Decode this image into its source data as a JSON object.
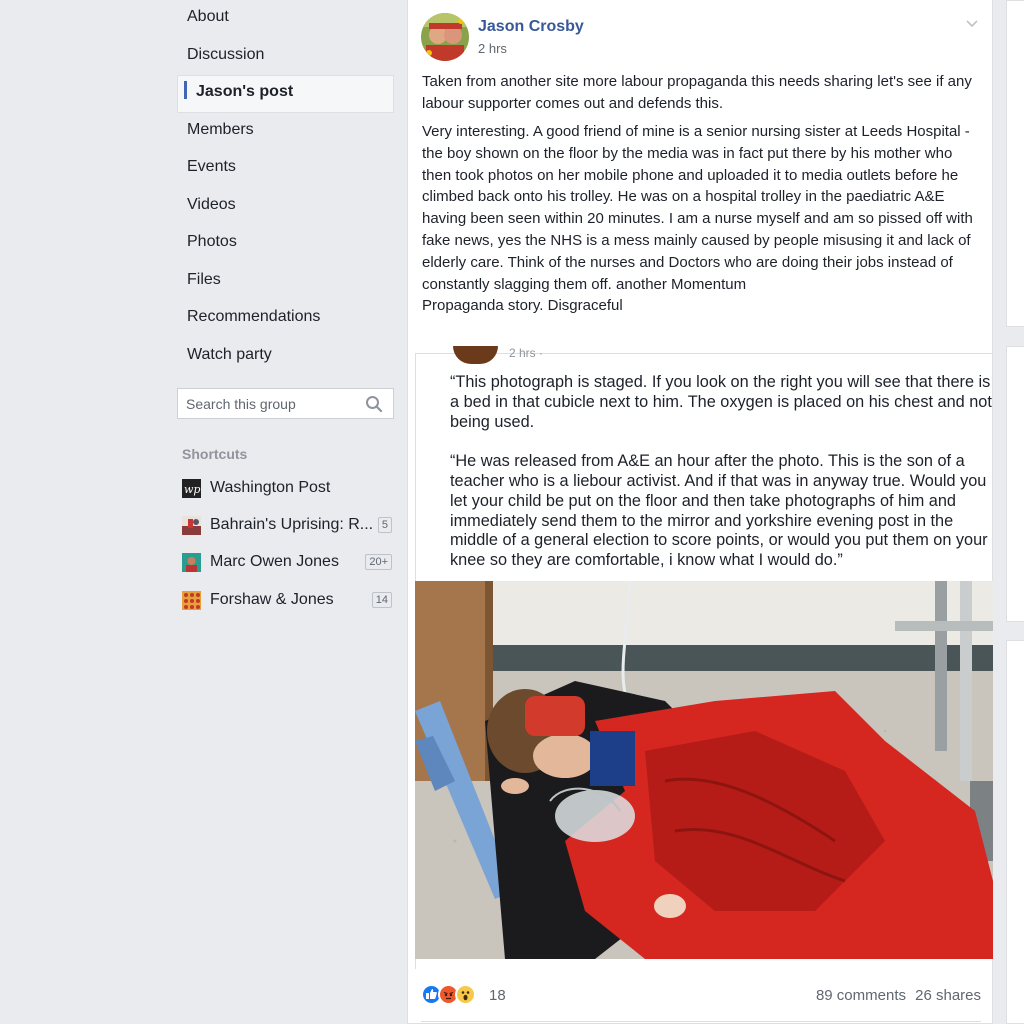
{
  "nav": {
    "items": [
      {
        "label": "About"
      },
      {
        "label": "Discussion"
      },
      {
        "label": "Jason's post",
        "active": true
      },
      {
        "label": "Members"
      },
      {
        "label": "Events"
      },
      {
        "label": "Videos"
      },
      {
        "label": "Photos"
      },
      {
        "label": "Files"
      },
      {
        "label": "Recommendations"
      },
      {
        "label": "Watch party"
      }
    ]
  },
  "search": {
    "placeholder": "Search this group"
  },
  "shortcuts": {
    "title": "Shortcuts",
    "items": [
      {
        "label": "Washington Post",
        "count": ""
      },
      {
        "label": "Bahrain's Uprising: R...",
        "count": "5"
      },
      {
        "label": "Marc Owen Jones",
        "count": "20+"
      },
      {
        "label": "Forshaw & Jones",
        "count": "14"
      }
    ]
  },
  "post": {
    "author": "Jason Crosby",
    "time": "2 hrs",
    "text_1": "Taken from another site more labour propaganda this needs sharing let's see if any labour supporter comes out and defends this.",
    "text_2": "Very interesting. A good friend of mine is a senior nursing sister at Leeds Hospital - the boy shown on the floor by the media was in fact put there by his mother who then took photos on her mobile phone and uploaded it to media outlets before he climbed back onto his trolley. He was on a hospital trolley in the paediatric A&E having been seen within 20 minutes. I am a nurse myself and am so pissed off with fake news, yes the NHS is a mess mainly caused by people misusing it and lack of elderly care. Think of the nurses and Doctors who are doing their jobs instead of constantly slagging them off. another Momentum\nPropaganda story. Disgraceful",
    "shared_time": "2 hrs ·",
    "quote": "“This photograph is staged. If you look on the right you will see that there is a bed in that cubicle next to him. The oxygen is placed on his chest and not being used.\n\n“He was released from A&E an hour after the photo. This is the son of a teacher who is a liebour activist. And if that was in anyway true. Would you let your child be put on the floor and then take photographs of him and immediately send them to the mirror and yorkshire evening post in the middle of a general election to score points, or would you put them on your knee so they are comfortable, i know what I would do.”",
    "reaction_count": "18",
    "comments": "89 comments",
    "shares": "26 shares"
  },
  "colors": {
    "link_blue": "#385898",
    "active_bar": "#4267b2",
    "like_blue": "#1877f2",
    "angry_orange": "#f0572a",
    "wow_yellow": "#f7c94b",
    "page_bg": "#e9ebee"
  }
}
